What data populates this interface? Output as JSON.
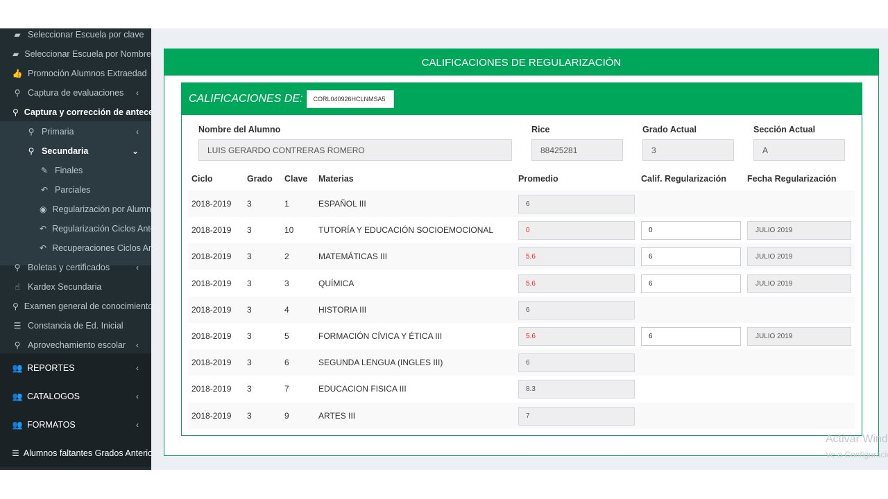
{
  "sidebar": {
    "items": [
      {
        "label": "Seleccionar Escuela por clave",
        "icon": "book-icon"
      },
      {
        "label": "Seleccionar Escuela por Nombre",
        "icon": "book-icon"
      },
      {
        "label": "Promoción Alumnos Extraedad",
        "icon": "thumbs-up-icon"
      },
      {
        "label": "Captura de evaluaciones",
        "icon": "search-icon"
      },
      {
        "label": "Captura y corrección de antecedentes",
        "icon": "search-icon"
      },
      {
        "label": "Primaria",
        "icon": "search-icon"
      },
      {
        "label": "Secundaria",
        "icon": "search-icon"
      },
      {
        "label": "Finales",
        "icon": "edit-icon"
      },
      {
        "label": "Parciales",
        "icon": "reply-icon"
      },
      {
        "label": "Regularización por Alumno",
        "icon": "radio-icon"
      },
      {
        "label": "Regularización Ciclos Anteriores",
        "icon": "reply-icon"
      },
      {
        "label": "Recuperaciones Ciclos Anteriores",
        "icon": "reply-icon"
      },
      {
        "label": "Boletas y certificados",
        "icon": "search-icon"
      },
      {
        "label": "Kardex Secundaria",
        "icon": "hand-icon"
      },
      {
        "label": "Examen general de conocimientos",
        "icon": "search-icon"
      },
      {
        "label": "Constancia de Ed. Inicial",
        "icon": "list-icon"
      },
      {
        "label": "Aprovechamiento escolar",
        "icon": "search-icon"
      }
    ],
    "sections": [
      {
        "label": "REPORTES",
        "icon": "users-icon"
      },
      {
        "label": "CATALOGOS",
        "icon": "users-icon"
      },
      {
        "label": "FORMATOS",
        "icon": "users-icon"
      },
      {
        "label": "Alumnos faltantes Grados Anteriores",
        "icon": "list-icon"
      }
    ]
  },
  "panel": {
    "title": "CALIFICACIONES DE REGULARIZACIÓN",
    "subtitle": "CALIFICACIONES DE:",
    "curp": "CORL040926HCLNMSA5"
  },
  "student": {
    "name_label": "Nombre del Alumno",
    "name": "LUIS GERARDO CONTRERAS ROMERO",
    "rice_label": "Rice",
    "rice": "88425281",
    "grado_label": "Grado Actual",
    "grado": "3",
    "seccion_label": "Sección Actual",
    "seccion": "A"
  },
  "table": {
    "headers": {
      "ciclo": "Ciclo",
      "grado": "Grado",
      "clave": "Clave",
      "materias": "Materias",
      "promedio": "Promedio",
      "calif": "Calif. Regularización",
      "fecha": "Fecha Regularización"
    },
    "rows": [
      {
        "ciclo": "2018-2019",
        "grado": "3",
        "clave": "1",
        "materia": "ESPAÑOL III",
        "promedio": "6",
        "low": false,
        "calif": null,
        "fecha": null
      },
      {
        "ciclo": "2018-2019",
        "grado": "3",
        "clave": "10",
        "materia": "TUTORÍA Y EDUCACIÓN SOCIOEMOCIONAL",
        "promedio": "0",
        "low": true,
        "calif": "0",
        "fecha": "JULIO 2019"
      },
      {
        "ciclo": "2018-2019",
        "grado": "3",
        "clave": "2",
        "materia": "MATEMÁTICAS III",
        "promedio": "5.6",
        "low": true,
        "calif": "6",
        "fecha": "JULIO 2019"
      },
      {
        "ciclo": "2018-2019",
        "grado": "3",
        "clave": "3",
        "materia": "QUÍMICA",
        "promedio": "5.6",
        "low": true,
        "calif": "6",
        "fecha": "JULIO 2019"
      },
      {
        "ciclo": "2018-2019",
        "grado": "3",
        "clave": "4",
        "materia": "HISTORIA III",
        "promedio": "6",
        "low": false,
        "calif": null,
        "fecha": null
      },
      {
        "ciclo": "2018-2019",
        "grado": "3",
        "clave": "5",
        "materia": "FORMACIÓN CÍVICA Y ÉTICA III",
        "promedio": "5.6",
        "low": true,
        "calif": "6",
        "fecha": "JULIO 2019"
      },
      {
        "ciclo": "2018-2019",
        "grado": "3",
        "clave": "6",
        "materia": "SEGUNDA LENGUA (INGLES III)",
        "promedio": "6",
        "low": false,
        "calif": null,
        "fecha": null
      },
      {
        "ciclo": "2018-2019",
        "grado": "3",
        "clave": "7",
        "materia": "EDUCACION FISICA III",
        "promedio": "8.3",
        "low": false,
        "calif": null,
        "fecha": null
      },
      {
        "ciclo": "2018-2019",
        "grado": "3",
        "clave": "9",
        "materia": "ARTES III",
        "promedio": "7",
        "low": false,
        "calif": null,
        "fecha": null
      }
    ]
  },
  "watermark": {
    "line1": "Activar Windows",
    "line2": "Ve a Configuración"
  },
  "colors": {
    "accent": "#00a65a",
    "sidebar": "#222d32",
    "low_grade": "#e8242a"
  }
}
